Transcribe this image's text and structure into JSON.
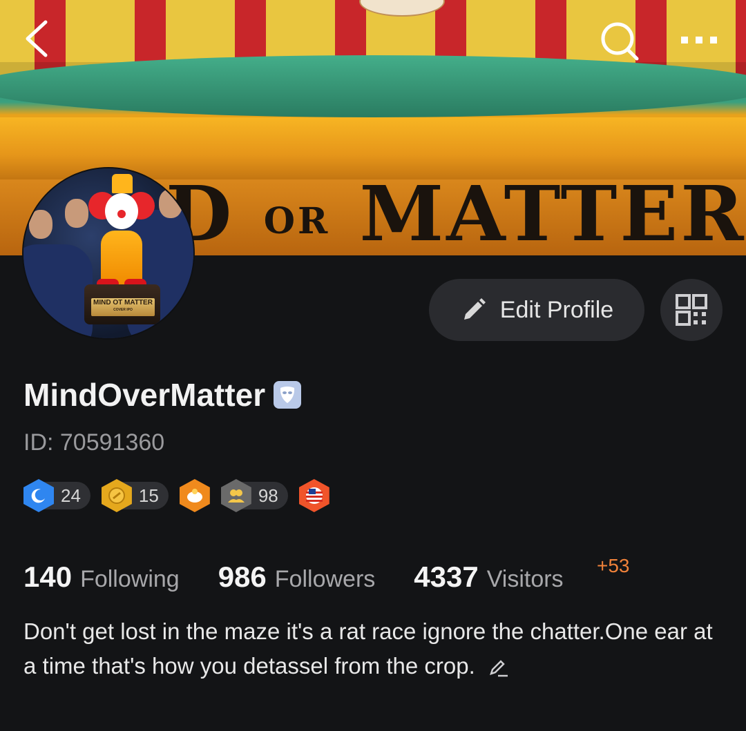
{
  "cover": {
    "banner_text_1": "D",
    "banner_text_small": "OR",
    "banner_text_2": "MATTER"
  },
  "avatar": {
    "plaque_text": "MIND OT MATTER",
    "plaque_subtext": "COVER IPO"
  },
  "header": {
    "edit_profile_label": "Edit Profile"
  },
  "profile": {
    "username": "MindOverMatter",
    "id_text": "ID: 70591360"
  },
  "badges": [
    {
      "icon": "moon-icon",
      "color": "#2f86f0",
      "count": "24"
    },
    {
      "icon": "coin-icon",
      "color": "#e5a81d",
      "count": "15"
    },
    {
      "icon": "piggy-bank-icon",
      "color": "#f08a1d",
      "count": ""
    },
    {
      "icon": "group-icon",
      "color": "#6a6a6a",
      "count": "98"
    },
    {
      "icon": "flag-icon",
      "color": "#f0542a",
      "count": ""
    }
  ],
  "stats": {
    "following_count": "140",
    "following_label": "Following",
    "followers_count": "986",
    "followers_label": "Followers",
    "visitors_count": "4337",
    "visitors_label": "Visitors",
    "visitors_delta": "+53"
  },
  "bio": {
    "text": "Don't get lost in the maze it's a rat race ignore the chatter.One ear at a time that's how you detassel from the crop."
  },
  "colors": {
    "background": "#131416",
    "button_bg": "#2a2b2f",
    "delta_orange": "#f0823a"
  }
}
